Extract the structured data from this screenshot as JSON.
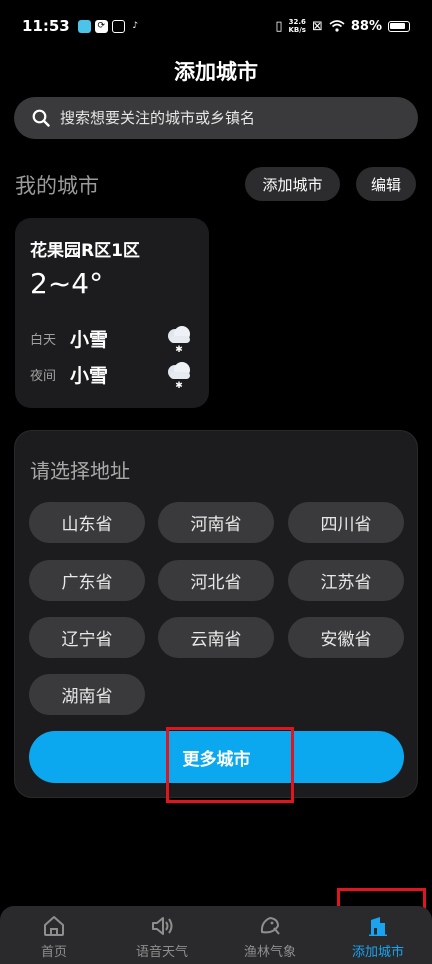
{
  "status": {
    "time": "11:53",
    "net_speed_value": "32.6",
    "net_speed_unit": "KB/s",
    "battery": "88%"
  },
  "page_title": "添加城市",
  "search": {
    "placeholder": "搜索想要关注的城市或乡镇名"
  },
  "my_cities": {
    "title": "我的城市",
    "add_label": "添加城市",
    "edit_label": "编辑"
  },
  "city_card": {
    "name": "花果园R区1区",
    "temp": "2~4°",
    "day_label": "白天",
    "day_cond": "小雪",
    "night_label": "夜间",
    "night_cond": "小雪"
  },
  "address": {
    "title": "请选择地址",
    "provinces": [
      "山东省",
      "河南省",
      "四川省",
      "广东省",
      "河北省",
      "江苏省",
      "辽宁省",
      "云南省",
      "安徽省",
      "湖南省"
    ],
    "more_label": "更多城市"
  },
  "nav": {
    "items": [
      "首页",
      "语音天气",
      "渔林气象",
      "添加城市"
    ],
    "active_index": 3
  },
  "colors": {
    "accent": "#0ba8f0",
    "highlight": "#e0161e"
  }
}
